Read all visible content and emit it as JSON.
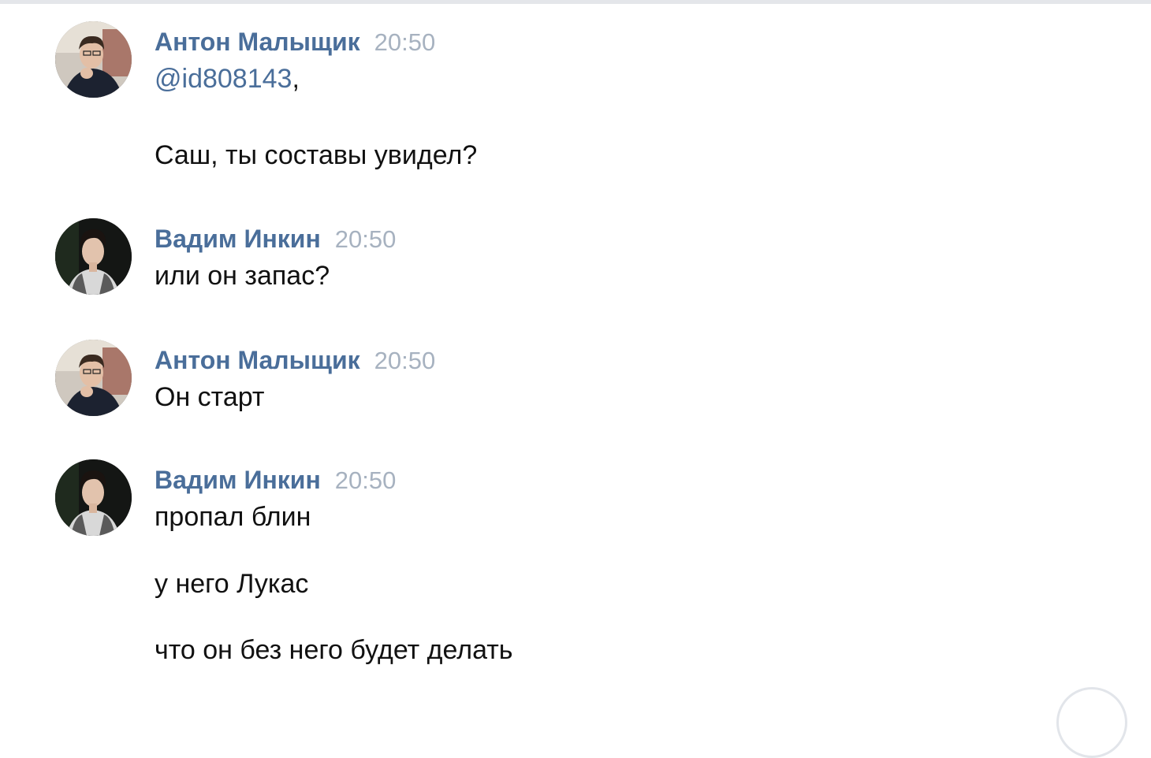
{
  "messages": [
    {
      "author": "Антон Малыщик",
      "time": "20:50",
      "avatar": "avatar-anton",
      "lines": [
        {
          "mention": "@id808143",
          "suffix": ","
        },
        {
          "text": "Саш, ты составы увидел?"
        }
      ]
    },
    {
      "author": "Вадим Инкин",
      "time": "20:50",
      "avatar": "avatar-vadim",
      "lines": [
        {
          "text": "или он запас?"
        }
      ]
    },
    {
      "author": "Антон Малыщик",
      "time": "20:50",
      "avatar": "avatar-anton",
      "lines": [
        {
          "text": "Он старт"
        }
      ]
    },
    {
      "author": "Вадим Инкин",
      "time": "20:50",
      "avatar": "avatar-vadim",
      "lines": [
        {
          "text": "пропал блин"
        },
        {
          "text": "у него Лукас"
        },
        {
          "text": "что он без него будет делать"
        }
      ]
    }
  ],
  "colors": {
    "author": "#4a6e9a",
    "time": "#a7b2c0",
    "text": "#111111",
    "mention": "#4a6e9a"
  }
}
